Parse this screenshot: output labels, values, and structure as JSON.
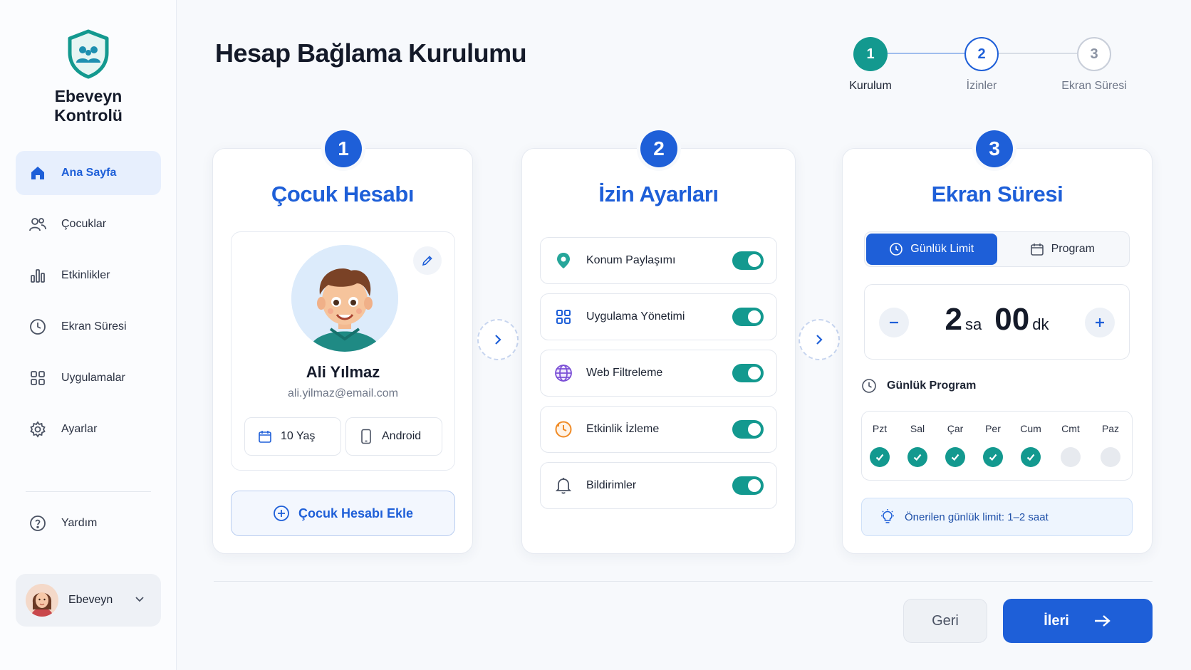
{
  "sidebar": {
    "brand": "Ebeveyn Kontrolü",
    "brand_icon": "shield-family-icon",
    "items": [
      {
        "label": "Ana Sayfa",
        "icon": "home-icon",
        "active": true
      },
      {
        "label": "Çocuklar",
        "icon": "users-icon"
      },
      {
        "label": "Etkinlikler",
        "icon": "bar-chart-icon"
      },
      {
        "label": "Ekran Süresi",
        "icon": "clock-icon"
      },
      {
        "label": "Uygulamalar",
        "icon": "apps-grid-icon"
      },
      {
        "label": "Ayarlar",
        "icon": "gear-icon"
      }
    ],
    "help": {
      "label": "Yardım",
      "icon": "help-circle-icon"
    },
    "profile": {
      "name": "Ebeveyn"
    }
  },
  "header": {
    "title": "Hesap Bağlama Kurulumu"
  },
  "stepper": {
    "steps": [
      {
        "num": "1",
        "label": "Kurulum",
        "state": "current"
      },
      {
        "num": "2",
        "label": "İzinler",
        "state": "next"
      },
      {
        "num": "3",
        "label": "Ekran Süresi",
        "state": "pending"
      }
    ]
  },
  "card1": {
    "num": "1",
    "title": "Çocuk Hesabı",
    "child_name": "Ali Yılmaz",
    "child_email": "ali.yilmaz@email.com",
    "age": "10 Yaş",
    "device": "Android",
    "add_button": "Çocuk Hesabı Ekle"
  },
  "card2": {
    "num": "2",
    "title": "İzin Ayarları",
    "permissions": [
      {
        "label": "Konum Paylaşımı",
        "icon": "location-pin-icon",
        "enabled": true
      },
      {
        "label": "Uygulama Yönetimi",
        "icon": "apps-grid-icon",
        "enabled": true
      },
      {
        "label": "Web Filtreleme",
        "icon": "globe-icon",
        "enabled": true
      },
      {
        "label": "Etkinlik İzleme",
        "icon": "activity-clock-icon",
        "enabled": true
      },
      {
        "label": "Bildirimler",
        "icon": "bell-icon",
        "enabled": true
      }
    ]
  },
  "card3": {
    "num": "3",
    "title": "Ekran Süresi",
    "tabs": [
      {
        "label": "Günlük Limit",
        "active": true
      },
      {
        "label": "Program",
        "active": false
      }
    ],
    "hours": "2",
    "hours_unit": "sa",
    "minutes": "00",
    "minutes_unit": "dk",
    "schedule_title": "Günlük Program",
    "days": [
      {
        "label": "Pzt",
        "on": true
      },
      {
        "label": "Sal",
        "on": true
      },
      {
        "label": "Çar",
        "on": true
      },
      {
        "label": "Per",
        "on": true
      },
      {
        "label": "Cum",
        "on": true
      },
      {
        "label": "Cmt",
        "on": false
      },
      {
        "label": "Paz",
        "on": false
      }
    ],
    "tip": "Önerilen günlük limit: 1–2 saat"
  },
  "footer": {
    "back": "Geri",
    "next": "İleri"
  },
  "colors": {
    "primary": "#1e5fd8",
    "teal": "#13998f",
    "brand_shield": "#13998f"
  }
}
